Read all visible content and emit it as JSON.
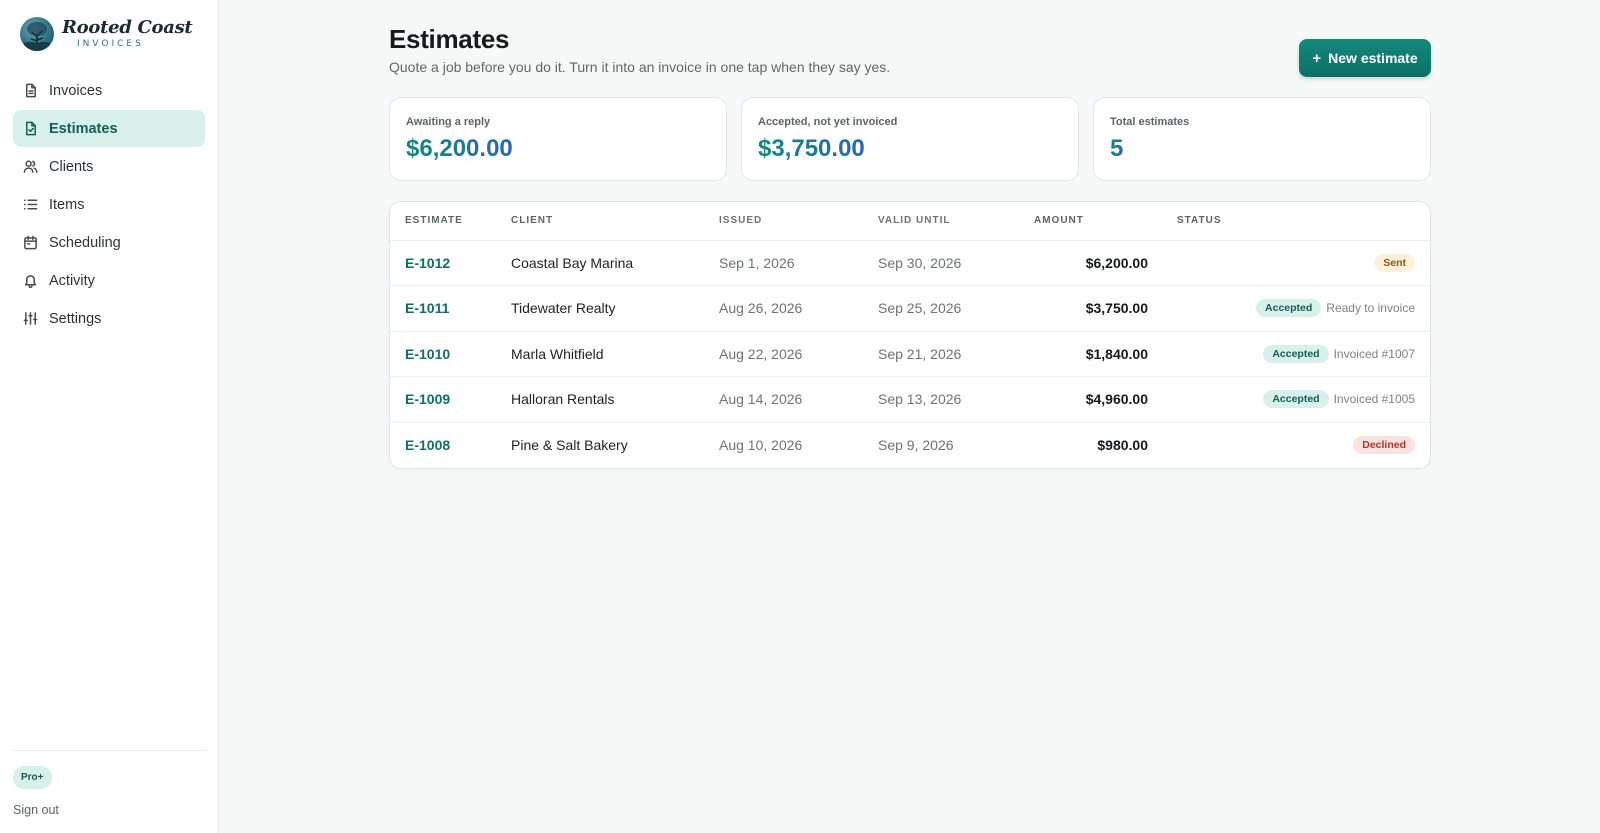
{
  "app": {
    "logo_script": "Rooted Coast",
    "logo_sub": "INVOICES"
  },
  "sidebar": {
    "items": [
      {
        "label": "Invoices",
        "icon": "document-icon"
      },
      {
        "label": "Estimates",
        "icon": "document-check-icon",
        "active": true
      },
      {
        "label": "Clients",
        "icon": "users-icon"
      },
      {
        "label": "Items",
        "icon": "list-icon"
      },
      {
        "label": "Scheduling",
        "icon": "calendar-icon"
      },
      {
        "label": "Activity",
        "icon": "bell-icon"
      },
      {
        "label": "Settings",
        "icon": "sliders-icon"
      }
    ],
    "plan_badge": "Pro+",
    "sign_out": "Sign out"
  },
  "page": {
    "title": "Estimates",
    "subtitle": "Quote a job before you do it. Turn it into an invoice in one tap when they say yes.",
    "new_button_icon": "+",
    "new_button": "New estimate"
  },
  "stats": [
    {
      "label": "Awaiting a reply",
      "value": "$6,200.00"
    },
    {
      "label": "Accepted, not yet invoiced",
      "value": "$3,750.00"
    },
    {
      "label": "Total estimates",
      "value": "5"
    }
  ],
  "table": {
    "headers": {
      "estimate": "ESTIMATE",
      "client": "CLIENT",
      "issued": "ISSUED",
      "valid_until": "VALID UNTIL",
      "amount": "AMOUNT",
      "status": "STATUS"
    },
    "rows": [
      {
        "id": "E-1012",
        "client": "Coastal Bay Marina",
        "issued": "Sep 1, 2026",
        "valid_until": "Sep 30, 2026",
        "amount": "$6,200.00",
        "status": "Sent",
        "status_kind": "sent",
        "note": ""
      },
      {
        "id": "E-1011",
        "client": "Tidewater Realty",
        "issued": "Aug 26, 2026",
        "valid_until": "Sep 25, 2026",
        "amount": "$3,750.00",
        "status": "Accepted",
        "status_kind": "accepted",
        "note": "Ready to invoice"
      },
      {
        "id": "E-1010",
        "client": "Marla Whitfield",
        "issued": "Aug 22, 2026",
        "valid_until": "Sep 21, 2026",
        "amount": "$1,840.00",
        "status": "Accepted",
        "status_kind": "accepted",
        "note": "Invoiced #1007"
      },
      {
        "id": "E-1009",
        "client": "Halloran Rentals",
        "issued": "Aug 14, 2026",
        "valid_until": "Sep 13, 2026",
        "amount": "$4,960.00",
        "status": "Accepted",
        "status_kind": "accepted",
        "note": "Invoiced #1005"
      },
      {
        "id": "E-1008",
        "client": "Pine & Salt Bakery",
        "issued": "Aug 10, 2026",
        "valid_until": "Sep 9, 2026",
        "amount": "$980.00",
        "status": "Declined",
        "status_kind": "declined",
        "note": ""
      }
    ]
  },
  "colors": {
    "accent": "#0f6f64",
    "active_bg": "#d8f0ea",
    "button": "#13897b",
    "sent_badge": "#fdf1dc",
    "declined_badge": "#fbe3e1"
  }
}
